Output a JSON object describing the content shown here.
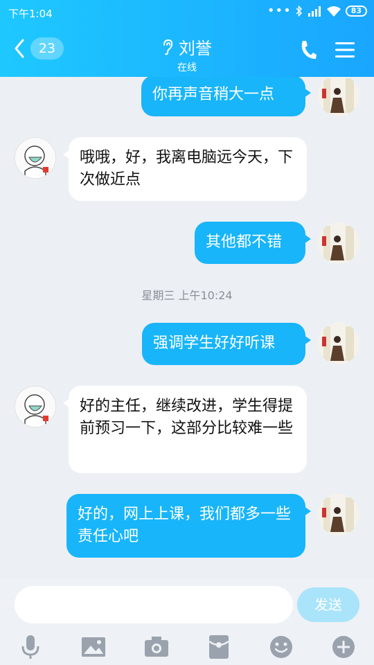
{
  "status_bar": {
    "time": "下午1:04",
    "dots": "•••",
    "battery": "83"
  },
  "header": {
    "unread_count": "23",
    "contact_name": "刘誉",
    "presence": "在线"
  },
  "messages": [
    {
      "side": "me",
      "text": "你再声音稍大一点"
    },
    {
      "side": "peer",
      "text": "哦哦，好，我离电脑远今天，下次做近点"
    },
    {
      "side": "me",
      "text": "其他都不错"
    },
    {
      "timestamp": "星期三 上午10:24"
    },
    {
      "side": "me",
      "text": "强调学生好好听课"
    },
    {
      "side": "peer",
      "text": "好的主任，继续改进，学生得提前预习一下，这部分比较难一些"
    },
    {
      "side": "me",
      "text": "好的，网上上课，我们都多一些责任心吧"
    }
  ],
  "input": {
    "placeholder": "",
    "send_label": "发送"
  },
  "toolbar": {
    "icons": [
      "microphone-icon",
      "image-icon",
      "camera-icon",
      "red-packet-icon",
      "emoji-icon",
      "plus-icon"
    ]
  },
  "colors": {
    "header": "#1aa6ff",
    "my_bubble": "#18b5fa",
    "send_disabled": "#a9e4fb",
    "icon_gray": "#9aa3ad"
  }
}
